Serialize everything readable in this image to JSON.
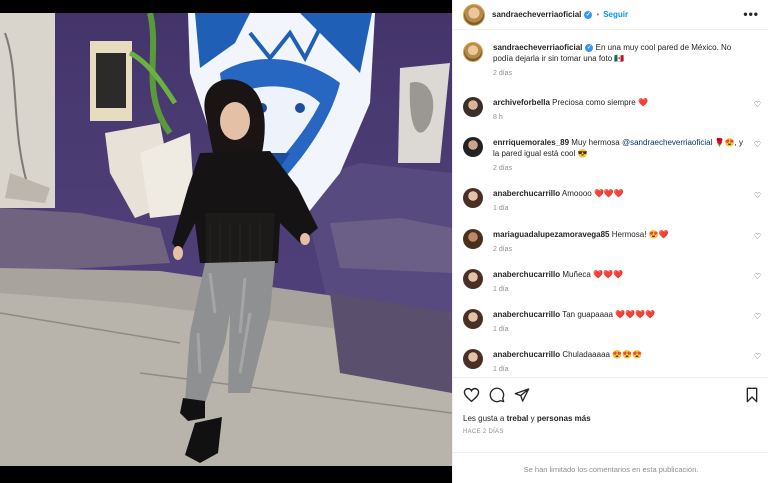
{
  "post": {
    "author": "sandraecheverriaoficial",
    "verified_mark": "✓",
    "dot": "•",
    "follow_label": "Seguir",
    "more_icon": "more-horizontal-icon",
    "caption": "En una muy cool pared de México. No podía dejarla ir sin tomar una foto 🇲🇽",
    "caption_time": "2 días"
  },
  "comments": [
    {
      "user": "archiveforbella",
      "text": "Preciosa como siempre ❤️",
      "time": "8 h"
    },
    {
      "user": "enrriquemorales_89",
      "text_before": "Muy hermosa ",
      "mention": "@sandraecheverriaoficial",
      "text_after": " 🌹😍, y la pared igual está cool 😎",
      "time": "2 días"
    },
    {
      "user": "anaberchucarrillo",
      "text": "Amoooo ❤️❤️❤️",
      "time": "1 día"
    },
    {
      "user": "mariaguadalupezamoravega85",
      "text": "Hermosa! 😍❤️",
      "time": "2 días"
    },
    {
      "user": "anaberchucarrillo",
      "text": "Muñeca ❤️❤️❤️",
      "time": "1 día"
    },
    {
      "user": "anaberchucarrillo",
      "text": "Tan guapaaaa ❤️❤️❤️❤️",
      "time": "1 día"
    },
    {
      "user": "anaberchucarrillo",
      "text": "Chuladaaaaa 😍😍😍",
      "time": "1 día"
    }
  ],
  "actions": {
    "likes_prefix": "Les gusta a ",
    "likes_user": "trebal",
    "likes_mid": " y ",
    "likes_more": "personas más",
    "date": "HACE 2 DÍAS",
    "limited_notice": "Se han limitado los comentarios en esta publicación."
  },
  "colors": {
    "accent": "#0095f6",
    "verified": "#3897f0",
    "heart": "#ed1c24",
    "muted": "#8e8e8e"
  }
}
